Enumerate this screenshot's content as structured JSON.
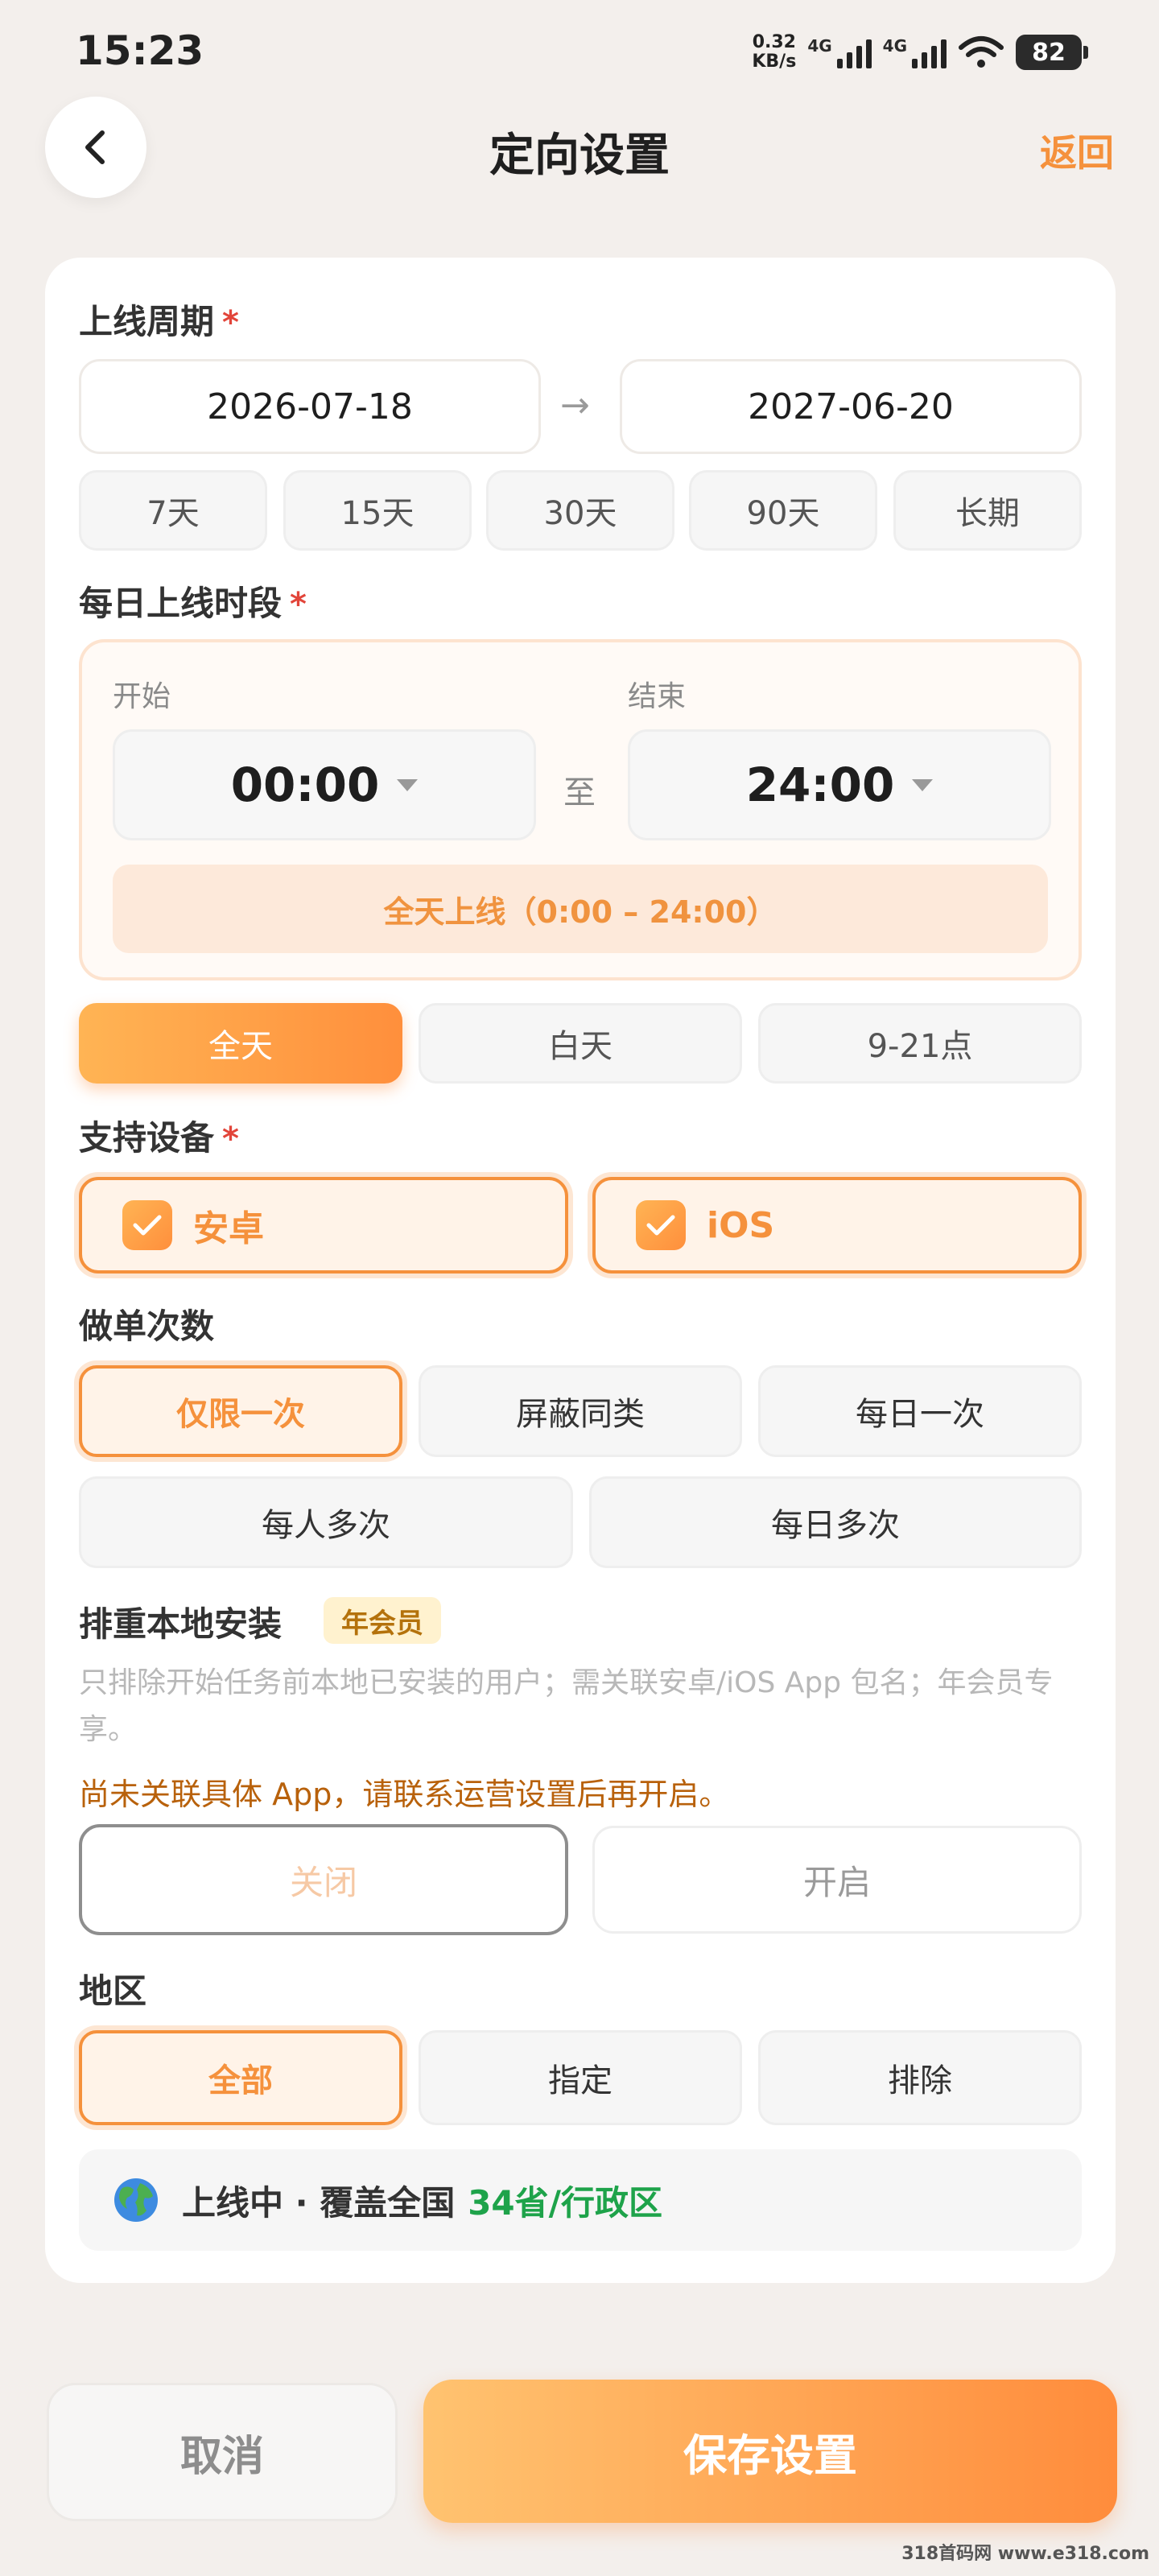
{
  "status_bar": {
    "time": "15:23",
    "net_speed_value": "0.32",
    "net_speed_unit": "KB/s",
    "sim1": "4G",
    "sim2": "4G",
    "battery": "82"
  },
  "header": {
    "title": "定向设置",
    "return_label": "返回"
  },
  "online_period": {
    "label": "上线周期",
    "required_mark": "*",
    "start_date": "2026-07-18",
    "end_date": "2027-06-20",
    "arrow": "→",
    "presets": [
      "7天",
      "15天",
      "30天",
      "90天",
      "长期"
    ]
  },
  "daily_window": {
    "label": "每日上线时段",
    "required_mark": "*",
    "start_label": "开始",
    "end_label": "结束",
    "start_time": "00:00",
    "end_time": "24:00",
    "to_text": "至",
    "summary": "全天上线（0:00 – 24:00）",
    "presets": [
      "全天",
      "白天",
      "9-21点"
    ],
    "selected_preset": "全天"
  },
  "devices": {
    "label": "支持设备",
    "required_mark": "*",
    "options": [
      {
        "label": "安卓",
        "checked": true
      },
      {
        "label": "iOS",
        "checked": true
      }
    ]
  },
  "order_count": {
    "label": "做单次数",
    "row1": [
      "仅限一次",
      "屏蔽同类",
      "每日一次"
    ],
    "row2": [
      "每人多次",
      "每日多次"
    ],
    "selected": "仅限一次"
  },
  "dedupe": {
    "label": "排重本地安装",
    "badge": "年会员",
    "description": "只排除开始任务前本地已安装的用户；需关联安卓/iOS App 包名；年会员专享。",
    "warning": "尚未关联具体 App，请联系运营设置后再开启。",
    "off_label": "关闭",
    "on_label": "开启",
    "state": "off"
  },
  "region": {
    "label": "地区",
    "options": [
      "全部",
      "指定",
      "排除"
    ],
    "selected": "全部",
    "status_prefix": "上线中 · 覆盖全国",
    "status_count": "34省/行政区"
  },
  "footer": {
    "cancel_label": "取消",
    "save_label": "保存设置"
  },
  "watermark": "318首码网 www.e318.com",
  "colors": {
    "accent": "#f5913c",
    "background": "#f3efec",
    "required": "#e2453a",
    "success": "#1ea34a"
  }
}
